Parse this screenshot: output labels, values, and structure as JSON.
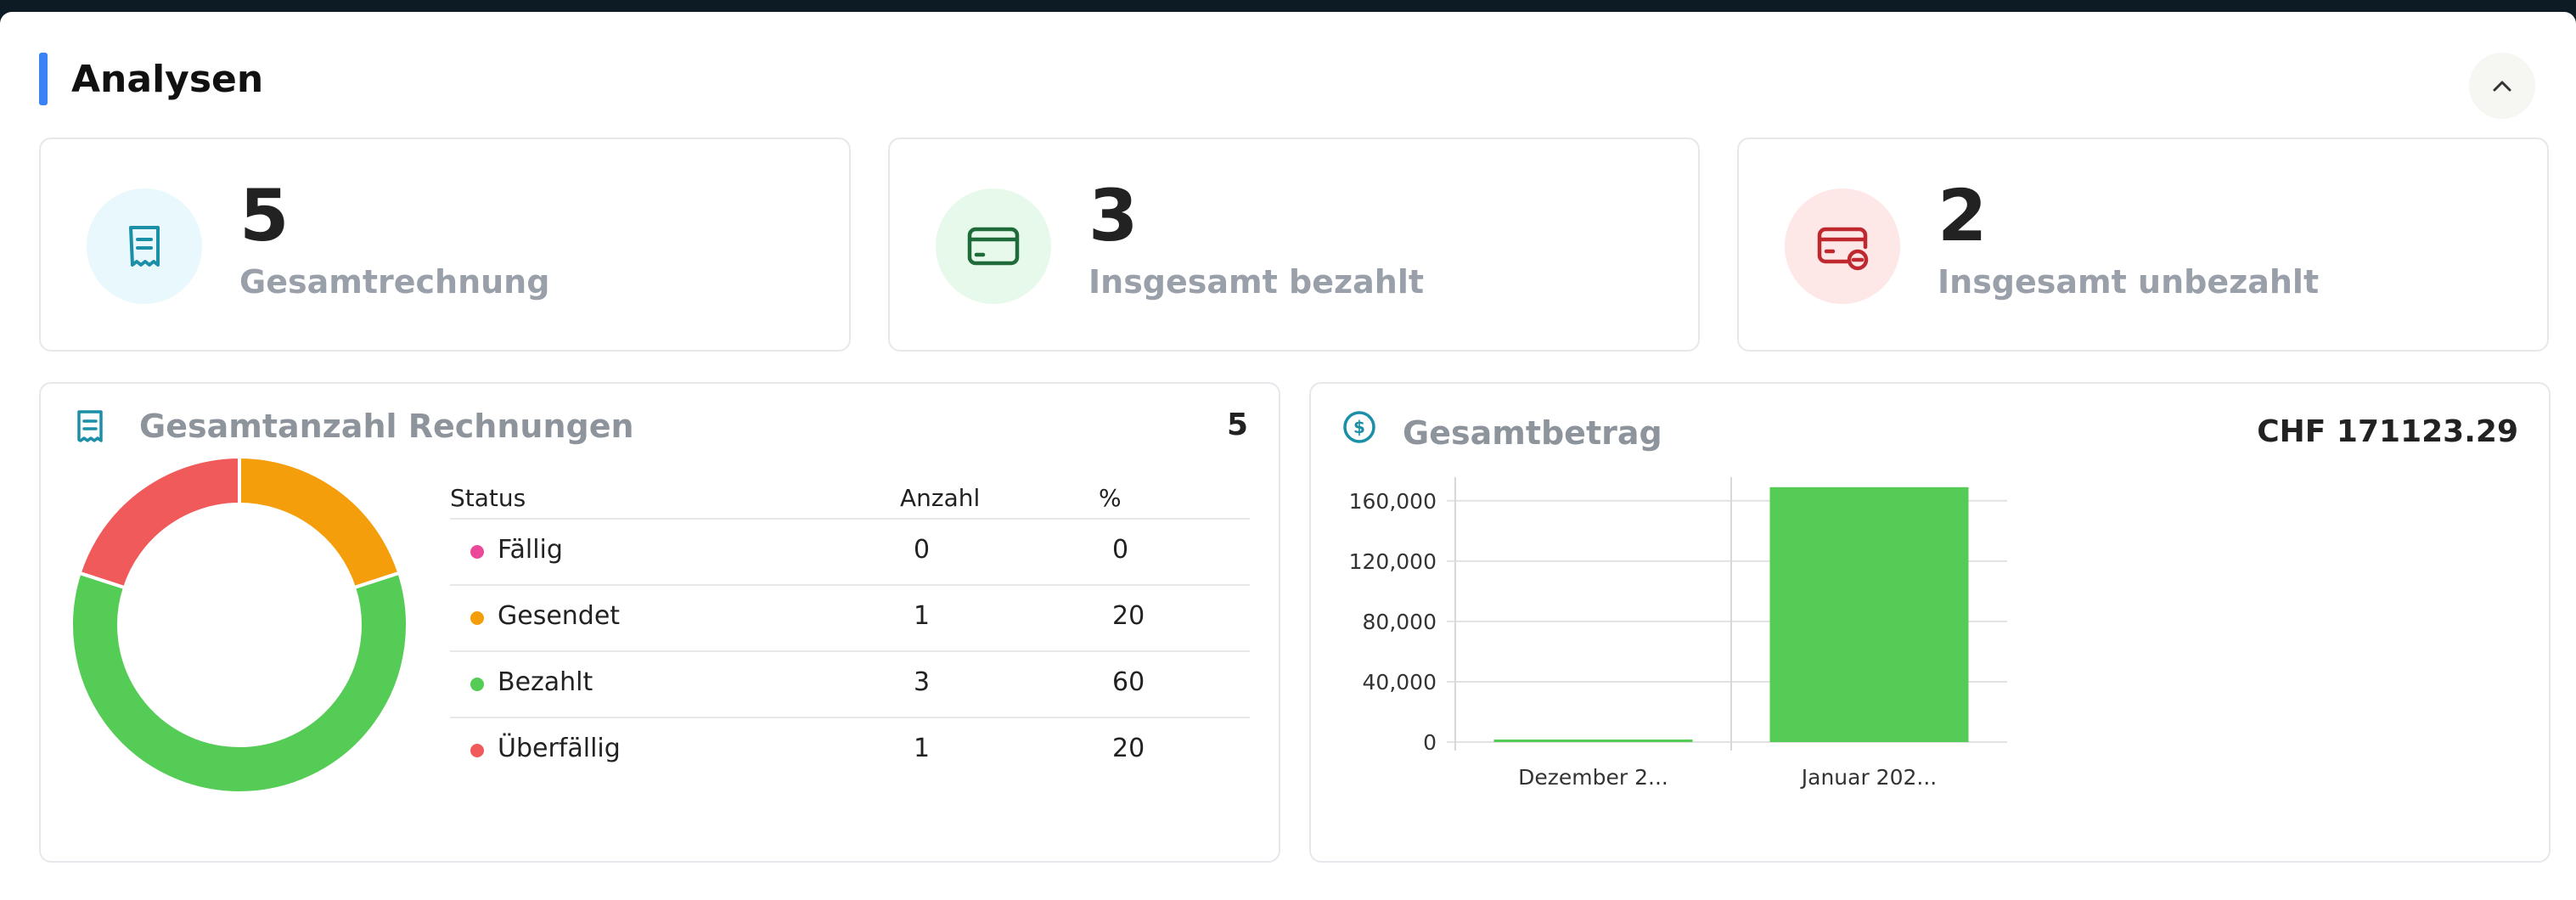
{
  "header": {
    "title": "Analysen"
  },
  "stats": [
    {
      "value": "5",
      "label": "Gesamtrechnung",
      "icon": "receipt-icon",
      "bg": "#e8f8fc",
      "fg": "#1b8fa8"
    },
    {
      "value": "3",
      "label": "Insgesamt bezahlt",
      "icon": "credit-card-icon",
      "bg": "#e7f9ea",
      "fg": "#1f6b3a"
    },
    {
      "value": "2",
      "label": "Insgesamt unbezahlt",
      "icon": "card-remove-icon",
      "bg": "#fde7e7",
      "fg": "#c0282f"
    }
  ],
  "invoices_panel": {
    "title": "Gesamtanzahl Rechnungen",
    "count": "5",
    "columns": [
      "Status",
      "Anzahl",
      "%"
    ],
    "rows": [
      {
        "status": "Fällig",
        "count": "0",
        "percent": "0",
        "color": "#ec4899"
      },
      {
        "status": "Gesendet",
        "count": "1",
        "percent": "20",
        "color": "#f59e0b"
      },
      {
        "status": "Bezahlt",
        "count": "3",
        "percent": "60",
        "color": "#55cc55"
      },
      {
        "status": "Überfällig",
        "count": "1",
        "percent": "20",
        "color": "#f05a5a"
      }
    ]
  },
  "amount_panel": {
    "title": "Gesamtbetrag",
    "total": "CHF 171123.29"
  },
  "chart_data": [
    {
      "type": "pie",
      "variant": "donut",
      "categories": [
        "Fällig",
        "Gesendet",
        "Bezahlt",
        "Überfällig"
      ],
      "values": [
        0,
        1,
        3,
        1
      ],
      "colors": [
        "#ec4899",
        "#f59e0b",
        "#55cc55",
        "#f05a5a"
      ]
    },
    {
      "type": "bar",
      "categories": [
        "Dezember 2...",
        "Januar 202..."
      ],
      "values": [
        1200,
        169000
      ],
      "ylim": [
        0,
        170000
      ],
      "yticks": [
        "0",
        "40,000",
        "80,000",
        "120,000",
        "160,000"
      ],
      "bar_color": "#55cc55",
      "grid": true
    }
  ]
}
